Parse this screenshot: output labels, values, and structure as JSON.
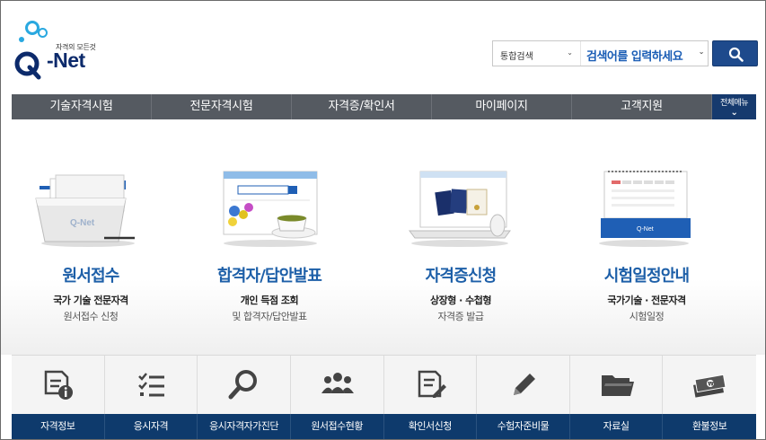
{
  "logo": {
    "tagline": "자격의 모든것",
    "brand": "-Net"
  },
  "search": {
    "scope": "통합검색",
    "placeholder": "검색어를 입력하세요"
  },
  "nav": {
    "items": [
      "기술자격시험",
      "전문자격시험",
      "자격증/확인서",
      "마이페이지",
      "고객지원"
    ],
    "all_menu": "전체메뉴"
  },
  "cards": [
    {
      "title": "원서접수",
      "line1": "국가 기술 전문자격",
      "line2": "원서접수 신청"
    },
    {
      "title": "합격자/답안발표",
      "line1": "개인 득점 조회",
      "line2": "및 합격자/답안발표"
    },
    {
      "title": "자격증신청",
      "line1": "상장형 · 수첩형",
      "line2": "자격증 발급"
    },
    {
      "title": "시험일정안내",
      "line1": "국가기술 · 전문자격",
      "line2": "시험일정"
    }
  ],
  "quick_links": [
    {
      "label": "자격정보",
      "icon": "document-info-icon"
    },
    {
      "label": "응시자격",
      "icon": "checklist-icon"
    },
    {
      "label": "응시자격자가진단",
      "icon": "magnifier-icon"
    },
    {
      "label": "원서접수현황",
      "icon": "users-group-icon"
    },
    {
      "label": "확인서신청",
      "icon": "document-edit-icon"
    },
    {
      "label": "수험자준비물",
      "icon": "pencil-icon"
    },
    {
      "label": "자료실",
      "icon": "folder-icon"
    },
    {
      "label": "환불정보",
      "icon": "money-icon"
    }
  ],
  "colors": {
    "brand_blue": "#1d5fa8",
    "nav_gray": "#555a61",
    "bottom_bar": "#0e3a6c",
    "search_button": "#1e4a8c"
  }
}
